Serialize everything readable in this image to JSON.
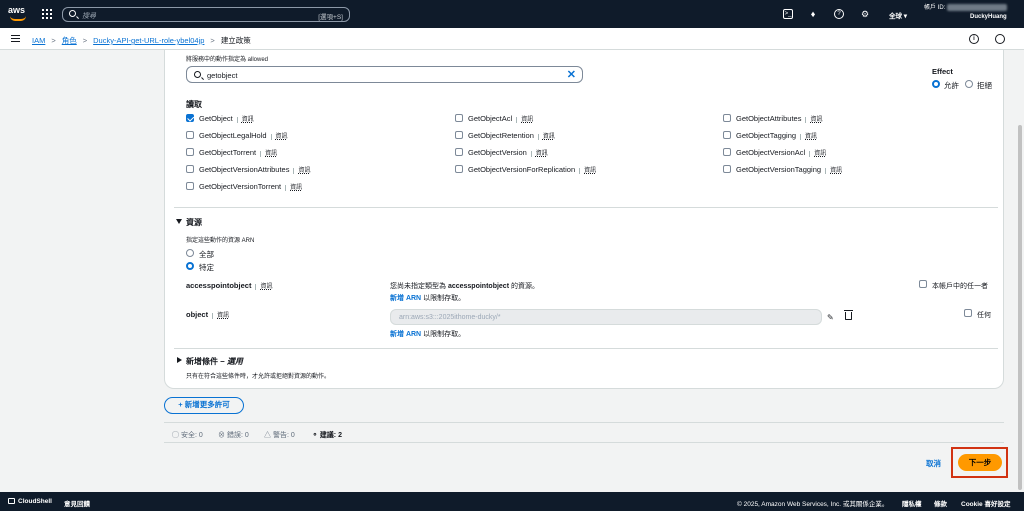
{
  "topnav": {
    "logo": "aws",
    "search_placeholder": "搜尋",
    "search_shortcut": "[選項+S]",
    "region": "全球 ▾",
    "account_label": "帳戶 ID:",
    "user": "DuckyHuang",
    "icons": [
      "services-grid-icon",
      "cloudshell-icon",
      "bell-icon",
      "help-icon",
      "gear-icon"
    ]
  },
  "breadcrumb": {
    "items": [
      "IAM",
      "角色",
      "Ducky-API-get-URL-role-ybel04jp"
    ],
    "current": "建立政策"
  },
  "actions": {
    "allowed_label": "將服務中的動作指定為 allowed",
    "filter_value": "getobject",
    "effect": {
      "title": "Effect",
      "allow": "允許",
      "deny": "拒絕",
      "selected": "允許"
    },
    "read_heading": "讀取",
    "info_label": "資訊",
    "items": [
      {
        "name": "GetObject",
        "checked": true
      },
      {
        "name": "GetObjectAcl",
        "checked": false
      },
      {
        "name": "GetObjectAttributes",
        "checked": false
      },
      {
        "name": "GetObjectLegalHold",
        "checked": false
      },
      {
        "name": "GetObjectRetention",
        "checked": false
      },
      {
        "name": "GetObjectTagging",
        "checked": false
      },
      {
        "name": "GetObjectTorrent",
        "checked": false
      },
      {
        "name": "GetObjectVersion",
        "checked": false
      },
      {
        "name": "GetObjectVersionAcl",
        "checked": false
      },
      {
        "name": "GetObjectVersionAttributes",
        "checked": false
      },
      {
        "name": "GetObjectVersionForReplication",
        "checked": false
      },
      {
        "name": "GetObjectVersionTagging",
        "checked": false
      },
      {
        "name": "GetObjectVersionTorrent",
        "checked": false
      }
    ]
  },
  "resources": {
    "heading": "資源",
    "arn_label": "指定這些動作的資源 ARN",
    "opt_all": "全部",
    "opt_specific": "特定",
    "selected": "特定",
    "ap_name": "accesspointobject",
    "ap_msg_prefix": "您尚未指定類型為",
    "ap_msg_bold": "accesspointobject",
    "ap_msg_suffix": "的資源。",
    "add_arn": "新增 ARN",
    "add_arn_suffix": "以限制存取。",
    "any_in_account": "本帳戶中的任一者",
    "obj_name": "object",
    "obj_arn_value": "arn:aws:s3:::2025ithome-ducky/*",
    "any": "任何"
  },
  "conditions": {
    "heading": "新增條件",
    "optional": "– 選用",
    "desc": "只有在符合這些條件時，才允許或拒絕對資源的動作。"
  },
  "add_more": "新增更多許可",
  "status": {
    "security": "安全: 0",
    "errors": "錯誤: 0",
    "warnings": "警告: 0",
    "suggestions": "建議: 2"
  },
  "buttons": {
    "cancel": "取消",
    "next": "下一步"
  },
  "footer": {
    "cloudshell": "CloudShell",
    "feedback": "意見回饋",
    "copyright": "© 2025, Amazon Web Services, Inc. 或其關係企業。",
    "privacy": "隱私權",
    "terms": "條款",
    "cookie": "Cookie 喜好設定"
  },
  "colors": {
    "accent": "#0972d3",
    "primary_button": "#ff9900",
    "nav_bg": "#0f1b2a",
    "highlight": "#d13212"
  }
}
